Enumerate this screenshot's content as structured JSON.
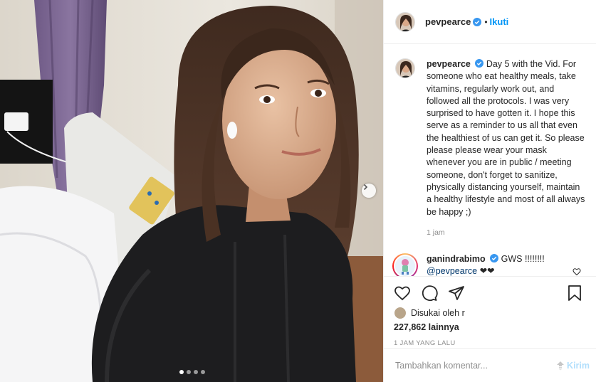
{
  "post": {
    "username": "pevpearce",
    "follow_label": "Ikuti",
    "bullet": "•",
    "caption": "Day 5 with the Vid. For someone who eat healthy meals, take vitamins, regularly work out, and followed all the protocols. I was very surprised to have gotten it. I hope this serve as a reminder to us all that even the healthiest of us can get it. So please please please wear your mask whenever you are in public / meeting someone, don't forget to sanitize, physically distancing yourself, maintain a healthy lifestyle and most of all always be happy ;)",
    "caption_time": "1 jam"
  },
  "reply": {
    "username": "ganindrabimo",
    "text": "GWS !!!!!!!!",
    "mention": "@pevpearce",
    "hearts": "❤❤"
  },
  "likes": {
    "liked_by_label": "Disukai oleh r",
    "count_label": "227,862 lainnya",
    "date": "1 JAM YANG LALU"
  },
  "composer": {
    "placeholder": "Tambahkan komentar...",
    "send_label": "Kirim"
  },
  "carousel": {
    "slide_count": 4,
    "active_index": 0
  },
  "colors": {
    "accent": "#0095f6",
    "verified": "#3897f0",
    "muted": "#8e8e8e",
    "send_disabled": "#b2dffc"
  },
  "icons": [
    "verified-badge-icon",
    "chevron-right-icon",
    "heart-icon",
    "comment-icon",
    "share-icon",
    "bookmark-icon",
    "emoji-icon"
  ]
}
